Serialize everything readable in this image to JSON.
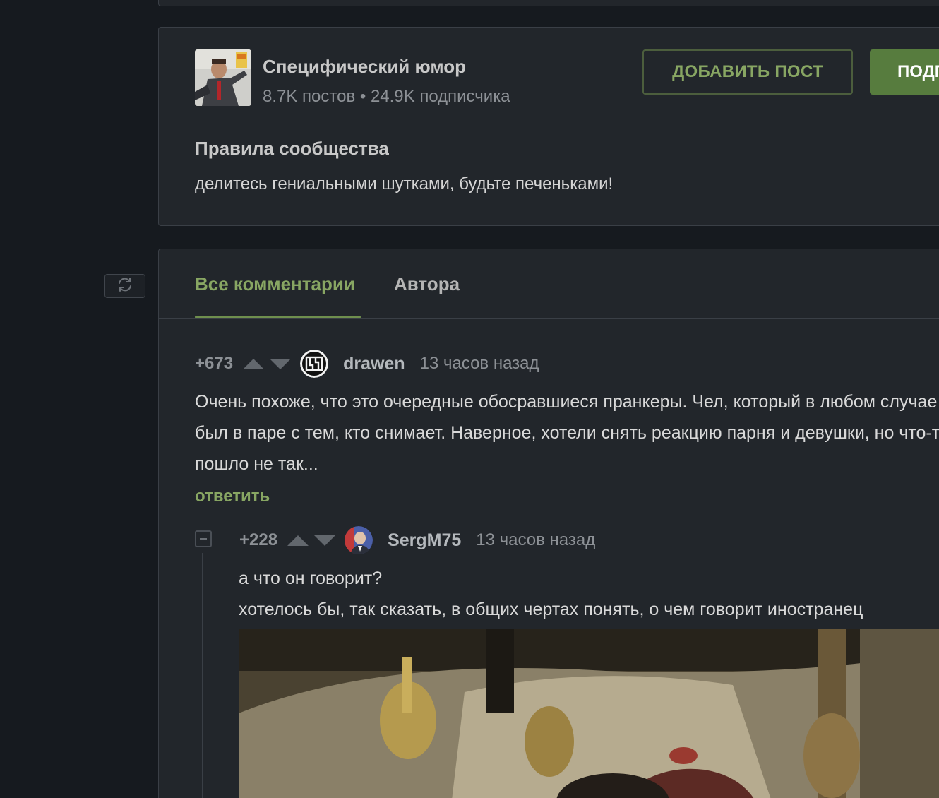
{
  "community": {
    "name": "Специфический юмор",
    "stats": "8.7K постов • 24.9K подписчика",
    "add_post_label": "ДОБАВИТЬ ПОСТ",
    "subscribe_label": "ПОДПИСАТЬСЯ",
    "rules_title": "Правила сообщества",
    "rules_text": "делитесь гениальными шутками, будьте печеньками!"
  },
  "comments_section": {
    "tabs": [
      {
        "label": "Все комментарии",
        "active": true
      },
      {
        "label": "Автора",
        "active": false
      }
    ],
    "comments": [
      {
        "rating": "+673",
        "username": "drawen",
        "time": "13 часов назад",
        "lines": [
          "Очень похоже, что это очередные обосравшиеся пранкеры. Чел, который в любом случае",
          "был в паре с тем, кто снимает. Наверное, хотели снять реакцию парня и девушки, но что-то",
          "пошло не так..."
        ],
        "reply_label": "ответить"
      },
      {
        "rating": "+228",
        "username": "SergM75",
        "time": "13 часов назад",
        "lines": [
          "а что он говорит?",
          "хотелось бы, так сказать, в общих чертах понять, о чем говорит иностранец"
        ]
      }
    ]
  },
  "colors": {
    "accent": "#88a663",
    "subscribe_bg": "#577c3e",
    "card_bg": "#22262b",
    "page_bg": "#161a1f"
  },
  "icons": {
    "refresh": "refresh-icon",
    "vote_up": "arrow-up-icon",
    "vote_down": "arrow-down-icon",
    "collapse": "collapse-minus-icon"
  }
}
